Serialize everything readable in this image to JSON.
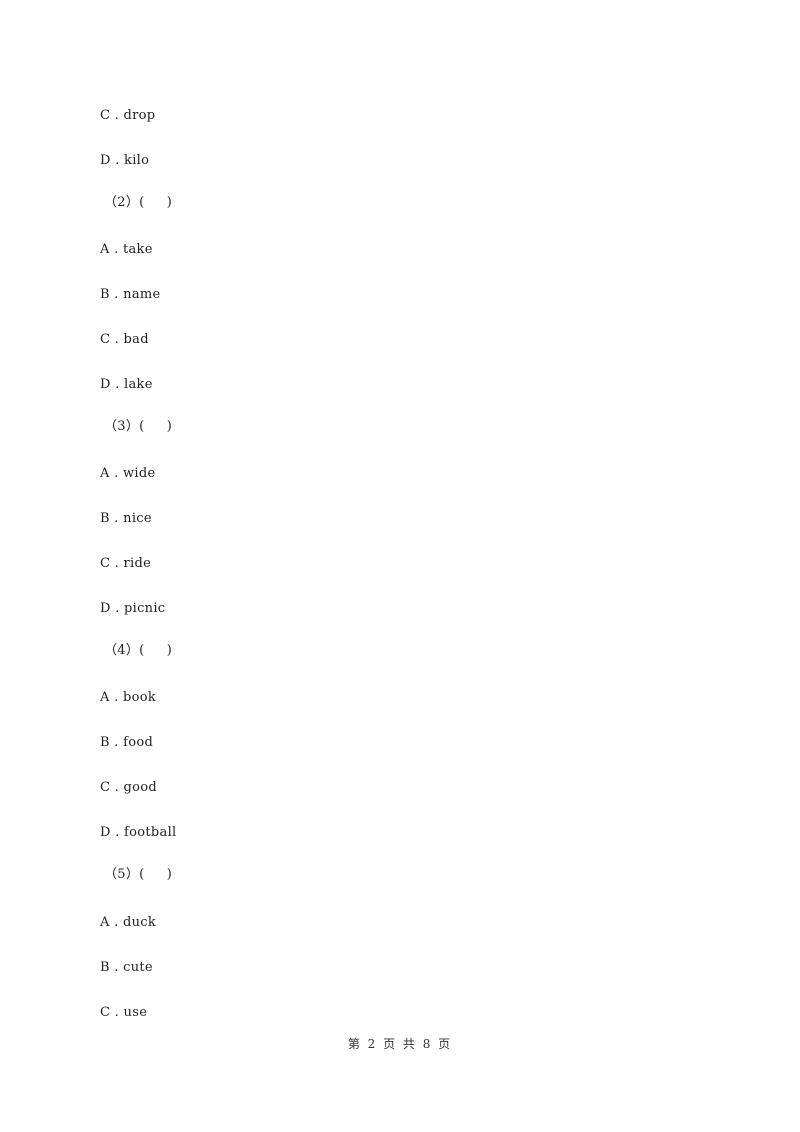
{
  "document": {
    "lines": [
      {
        "type": "option",
        "text": "C . drop"
      },
      {
        "type": "option",
        "text": "D . kilo"
      },
      {
        "type": "question",
        "text": "（2）(     )"
      },
      {
        "type": "option",
        "text": "A . take"
      },
      {
        "type": "option",
        "text": "B . name"
      },
      {
        "type": "option",
        "text": "C . bad"
      },
      {
        "type": "option",
        "text": "D . lake"
      },
      {
        "type": "question",
        "text": "（3）(     )"
      },
      {
        "type": "option",
        "text": "A . wide"
      },
      {
        "type": "option",
        "text": "B . nice"
      },
      {
        "type": "option",
        "text": "C . ride"
      },
      {
        "type": "option",
        "text": "D . picnic"
      },
      {
        "type": "question",
        "text": "（4）(     )"
      },
      {
        "type": "option",
        "text": "A . book"
      },
      {
        "type": "option",
        "text": "B . food"
      },
      {
        "type": "option",
        "text": "C . good"
      },
      {
        "type": "option",
        "text": "D . football"
      },
      {
        "type": "question",
        "text": "（5）(     )"
      },
      {
        "type": "option",
        "text": "A . duck"
      },
      {
        "type": "option",
        "text": "B . cute"
      },
      {
        "type": "option",
        "text": "C . use"
      }
    ]
  },
  "footer": {
    "page_label": "第 2 页 共 8 页"
  }
}
